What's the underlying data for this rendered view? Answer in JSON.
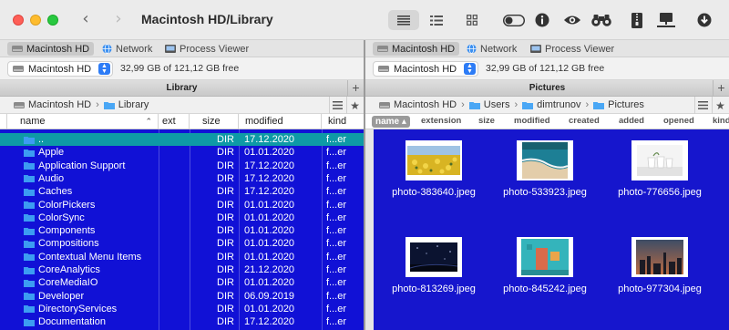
{
  "window": {
    "title": "Macintosh HD/Library"
  },
  "toolbar": {
    "back": "‹",
    "forward": "›",
    "icons": [
      "list-view-icon",
      "detail-view-icon",
      "grid-view-icon",
      "toggle-icon",
      "info-icon",
      "eye-icon",
      "binoculars-icon",
      "zip-icon",
      "monitor-icon",
      "download-icon"
    ]
  },
  "left": {
    "tabs": [
      "Macintosh HD",
      "Network",
      "Process Viewer"
    ],
    "drive": "Macintosh HD",
    "free_space": "32,99 GB of 121,12 GB free",
    "panel_title": "Library",
    "path": [
      "Macintosh HD",
      "Library"
    ],
    "columns": [
      "name",
      "ext",
      "size",
      "modified",
      "kind"
    ],
    "rows": [
      {
        "name": "..",
        "size": "DIR",
        "modified": "17.12.2020",
        "kind": "f...er"
      },
      {
        "name": "Apple",
        "size": "DIR",
        "modified": "01.01.2020",
        "kind": "f...er"
      },
      {
        "name": "Application Support",
        "size": "DIR",
        "modified": "17.12.2020",
        "kind": "f...er"
      },
      {
        "name": "Audio",
        "size": "DIR",
        "modified": "17.12.2020",
        "kind": "f...er"
      },
      {
        "name": "Caches",
        "size": "DIR",
        "modified": "17.12.2020",
        "kind": "f...er"
      },
      {
        "name": "ColorPickers",
        "size": "DIR",
        "modified": "01.01.2020",
        "kind": "f...er"
      },
      {
        "name": "ColorSync",
        "size": "DIR",
        "modified": "01.01.2020",
        "kind": "f...er"
      },
      {
        "name": "Components",
        "size": "DIR",
        "modified": "01.01.2020",
        "kind": "f...er"
      },
      {
        "name": "Compositions",
        "size": "DIR",
        "modified": "01.01.2020",
        "kind": "f...er"
      },
      {
        "name": "Contextual Menu Items",
        "size": "DIR",
        "modified": "01.01.2020",
        "kind": "f...er"
      },
      {
        "name": "CoreAnalytics",
        "size": "DIR",
        "modified": "21.12.2020",
        "kind": "f...er"
      },
      {
        "name": "CoreMediaIO",
        "size": "DIR",
        "modified": "01.01.2020",
        "kind": "f...er"
      },
      {
        "name": "Developer",
        "size": "DIR",
        "modified": "06.09.2019",
        "kind": "f...er"
      },
      {
        "name": "DirectoryServices",
        "size": "DIR",
        "modified": "01.01.2020",
        "kind": "f...er"
      },
      {
        "name": "Documentation",
        "size": "DIR",
        "modified": "17.12.2020",
        "kind": "f...er"
      }
    ]
  },
  "right": {
    "tabs": [
      "Macintosh HD",
      "Network",
      "Process Viewer"
    ],
    "drive": "Macintosh HD",
    "free_space": "32,99 GB of 121,12 GB free",
    "panel_title": "Pictures",
    "path": [
      "Macintosh HD",
      "Users",
      "dimtrunov",
      "Pictures"
    ],
    "columns": [
      "name",
      "extension",
      "size",
      "modified",
      "created",
      "added",
      "opened",
      "kind"
    ],
    "files": [
      {
        "name": "photo-383640.jpeg",
        "thumb": "yellow-flowers"
      },
      {
        "name": "photo-533923.jpeg",
        "thumb": "beach-aerial"
      },
      {
        "name": "photo-776656.jpeg",
        "thumb": "white-cups"
      },
      {
        "name": "photo-813269.jpeg",
        "thumb": "night-sky"
      },
      {
        "name": "photo-845242.jpeg",
        "thumb": "teal-door"
      },
      {
        "name": "photo-977304.jpeg",
        "thumb": "sunset-skyline"
      }
    ]
  },
  "colors": {
    "list_bg": "#1111d6",
    "cursor_row": "#0e9aa6",
    "grid_bg": "#1616cd",
    "folder": "#3c9df2",
    "accent": "#2d7cf6"
  }
}
